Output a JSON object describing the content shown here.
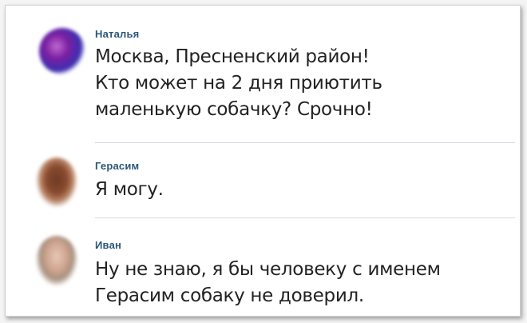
{
  "comments": [
    {
      "author": "Наталья",
      "lines": [
        "Москва, Пресненский район!",
        "Кто может на 2 дня приютить",
        "маленькую собачку? Срочно!"
      ]
    },
    {
      "author": "Герасим",
      "lines": [
        "Я могу."
      ]
    },
    {
      "author": "Иван",
      "lines": [
        "Ну не знаю, я бы человеку с именем",
        "Герасим собаку не доверил."
      ]
    }
  ]
}
